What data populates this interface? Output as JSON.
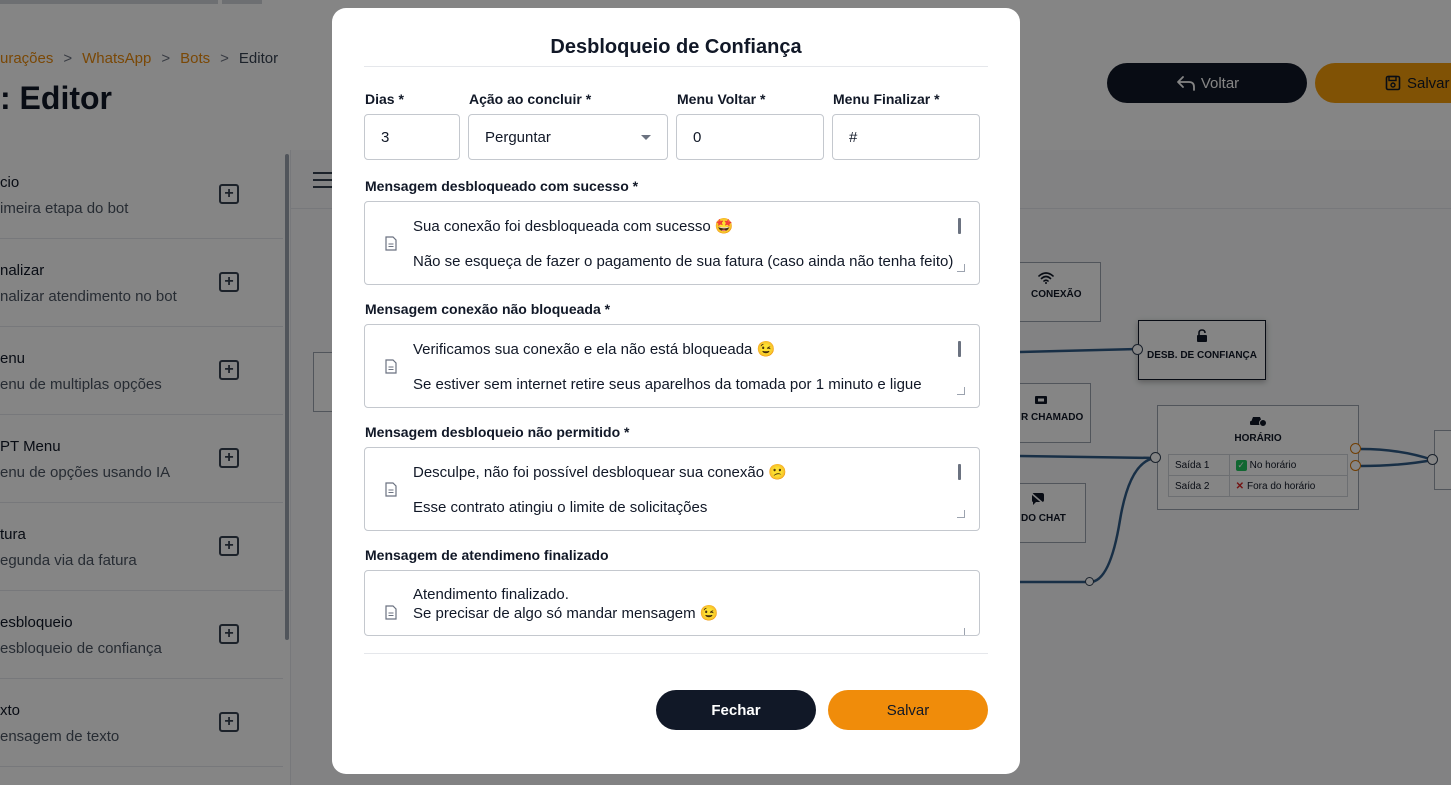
{
  "breadcrumb": {
    "items": [
      "urações",
      "WhatsApp",
      "Bots"
    ],
    "current": "Editor",
    "separator": ">"
  },
  "page": {
    "title": "Editor"
  },
  "header_buttons": {
    "back_label": "Voltar",
    "save_label": "Salvar"
  },
  "sidebar": {
    "items": [
      {
        "name": "cio",
        "description": "imeira etapa do bot"
      },
      {
        "name": "nalizar",
        "description": "nalizar atendimento no bot"
      },
      {
        "name": "enu",
        "description": "enu de multiplas opções"
      },
      {
        "name": "PT Menu",
        "description": "enu de opções usando IA"
      },
      {
        "name": "tura",
        "description": "egunda via da fatura"
      },
      {
        "name": "esbloqueio",
        "description": "esbloqueio de confiança"
      },
      {
        "name": "xto",
        "description": "ensagem de texto"
      }
    ]
  },
  "flow": {
    "nodes": {
      "conexao": "CONEXÃO",
      "desbloqueio": "DESB. DE CONFIANÇA",
      "chamado": "R CHAMADO",
      "chat": "DO CHAT",
      "horario": "HORÁRIO"
    },
    "horario_rows": [
      {
        "output": "Saída 1",
        "status": "No horário"
      },
      {
        "output": "Saída 2",
        "status": "Fora do horário"
      }
    ]
  },
  "modal": {
    "title": "Desbloqueio de Confiança",
    "fields": {
      "dias": {
        "label": "Dias *",
        "value": "3"
      },
      "acao": {
        "label": "Ação ao concluir *",
        "value": "Perguntar"
      },
      "menu_voltar": {
        "label": "Menu Voltar *",
        "value": "0"
      },
      "menu_finalizar": {
        "label": "Menu Finalizar *",
        "value": "#"
      }
    },
    "messages": [
      {
        "label": "Mensagem desbloqueado com sucesso *",
        "line1": "Sua conexão foi desbloqueada com sucesso 🤩",
        "line2": "Não se esqueça de fazer o pagamento de sua fatura (caso ainda não tenha feito)"
      },
      {
        "label": "Mensagem conexão não bloqueada *",
        "line1": "Verificamos sua conexão e ela não está bloqueada 😉",
        "line2": "Se estiver sem internet retire seus aparelhos da tomada por 1 minuto e ligue"
      },
      {
        "label": "Mensagem desbloqueio não permitido *",
        "line1": "Desculpe, não foi possível desbloquear sua conexão 😕",
        "line2": "Esse contrato atingiu o limite de solicitações"
      },
      {
        "label": "Mensagem de atendimeno finalizado",
        "line1": "Atendimento finalizado.",
        "line2": "Se precisar de algo só mandar mensagem 😉"
      }
    ],
    "buttons": {
      "close_label": "Fechar",
      "save_label": "Salvar"
    }
  },
  "colors": {
    "accent": "#f08c0a",
    "dark": "#111827",
    "link": "#ea8a0c"
  }
}
